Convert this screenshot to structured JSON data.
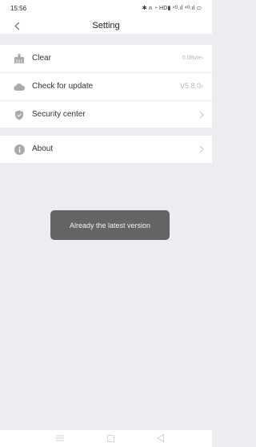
{
  "status_bar": {
    "time": "15:56",
    "indicators": "✱ ⍝ ◔ HD▮ ⁴ᴳ.ıl ⁴ᴳ.ıl ⬭"
  },
  "header": {
    "title": "Setting",
    "back_icon": "chevron-left-icon"
  },
  "settings": {
    "items": [
      {
        "label": "Clear",
        "value": "0.0Byte",
        "icon": "broom-icon",
        "has_chevron": true
      },
      {
        "label": "Check for update",
        "value": "V5.8.0",
        "icon": "cloud-icon",
        "has_chevron": true
      },
      {
        "label": "Security center",
        "value": "",
        "icon": "shield-icon",
        "has_chevron": true
      },
      {
        "label": "About",
        "value": "",
        "icon": "info-icon",
        "has_chevron": true
      }
    ]
  },
  "toast": {
    "message": "Already the latest version"
  },
  "system_nav": {
    "buttons": [
      "menu-icon",
      "home-icon",
      "back-triangle-icon"
    ]
  },
  "colors": {
    "background": "#ebedf1",
    "surface": "#ffffff",
    "icon_gray": "#a9a9a9",
    "secondary_text": "#b5b5b5",
    "toast_bg": "#585858"
  }
}
